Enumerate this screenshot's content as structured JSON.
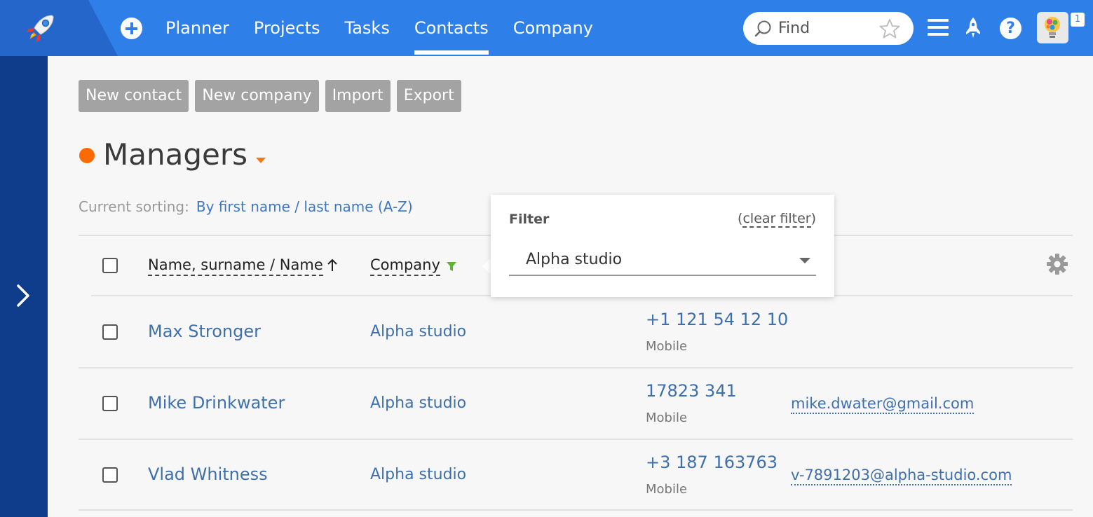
{
  "topbar": {
    "nav": [
      "Planner",
      "Projects",
      "Tasks",
      "Contacts",
      "Company"
    ],
    "active_nav": "Contacts",
    "search_placeholder": "Find",
    "notification_count": "1"
  },
  "toolbar": {
    "new_contact": "New contact",
    "new_company": "New company",
    "import": "Import",
    "export": "Export"
  },
  "page": {
    "title": "Managers",
    "sorting_label": "Current sorting:",
    "sorting_value": "By first name / last name (A-Z)"
  },
  "table": {
    "headers": {
      "name": "Name, surname / Name",
      "company": "Company"
    },
    "rows": [
      {
        "name": "Max Stronger",
        "company": "Alpha studio",
        "phone": "+1 121 54 12 10",
        "phone_type": "Mobile",
        "email": ""
      },
      {
        "name": "Mike Drinkwater",
        "company": "Alpha studio",
        "phone": "17823 341",
        "phone_type": "Mobile",
        "email": "mike.dwater@gmail.com"
      },
      {
        "name": "Vlad Whitness",
        "company": "Alpha studio",
        "phone": "+3 187 163763",
        "phone_type": "Mobile",
        "email": "v-7891203@alpha-studio.com"
      }
    ]
  },
  "filter_popup": {
    "title": "Filter",
    "clear_open": "(",
    "clear_label": "clear filter",
    "clear_close": ")",
    "selected": "Alpha studio"
  },
  "colors": {
    "topbar": "#2f7fe8",
    "sidebar": "#0f3d8c",
    "accent_dot": "#ff6a00",
    "link": "#3e70ad",
    "filter_active": "#5fb336"
  },
  "icons": [
    "rocket-logo-icon",
    "plus-icon",
    "search-icon",
    "star-icon",
    "menu-icon",
    "rocket-icon",
    "help-icon",
    "chevron-right-icon",
    "sort-up-icon",
    "filter-icon",
    "gear-icon",
    "caret-down-icon"
  ]
}
